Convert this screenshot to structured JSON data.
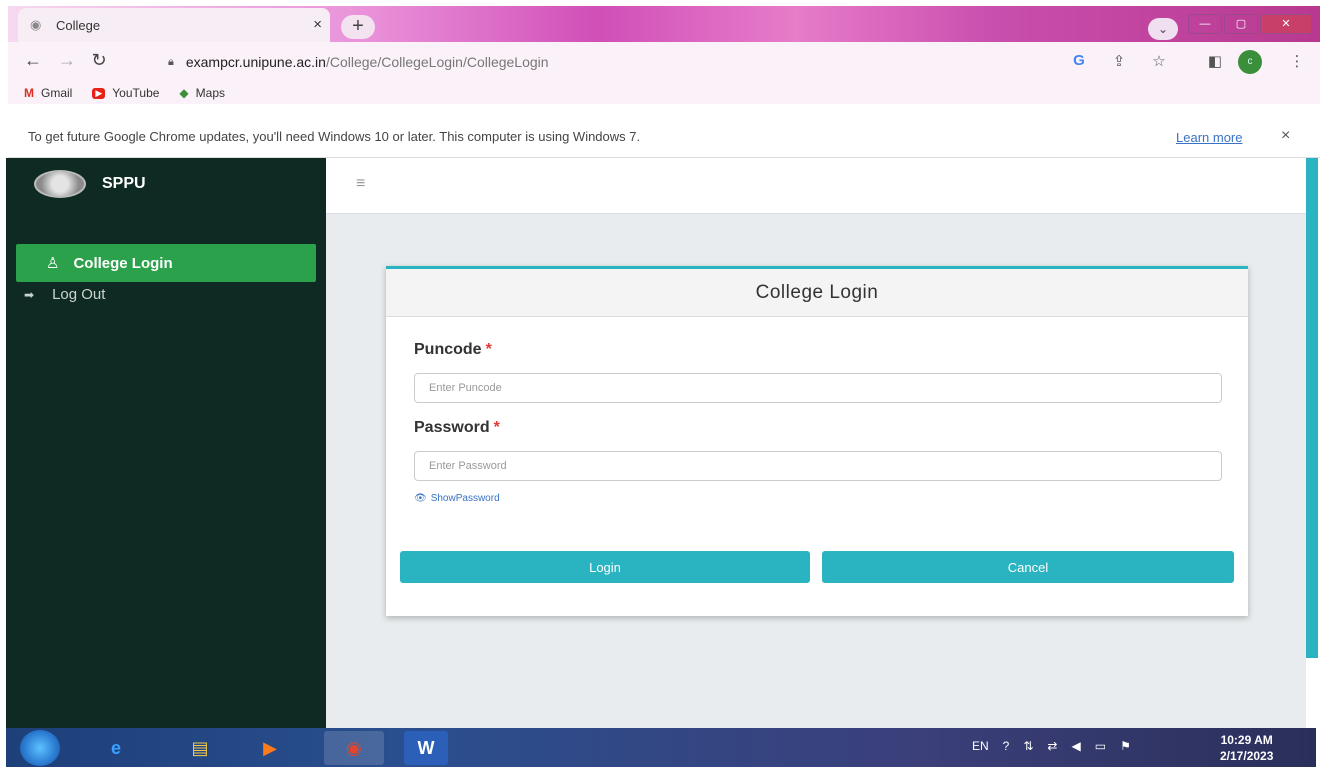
{
  "browser": {
    "tab_title": "College",
    "tab_close": "×",
    "new_tab": "+",
    "url_host": "exampcr.unipune.ac.in",
    "url_path": "/College/CollegeLogin/CollegeLogin",
    "profile_initial": "c"
  },
  "bookmarks": [
    {
      "label": "Gmail",
      "icon": "gmail-icon",
      "glyph": "M",
      "color": "#d93025"
    },
    {
      "label": "YouTube",
      "icon": "youtube-icon",
      "glyph": "▶",
      "color": "#e62117"
    },
    {
      "label": "Maps",
      "icon": "maps-icon",
      "glyph": "◆",
      "color": "#3b8f3a"
    }
  ],
  "infobar": {
    "message": "To get future Google Chrome updates, you'll need Windows 10 or later. This computer is using Windows 7.",
    "learn_more": "Learn more",
    "close": "×"
  },
  "sidebar": {
    "brand": "SPPU",
    "items": [
      {
        "label": "College Login",
        "icon": "user-icon",
        "active": true
      },
      {
        "label": "Log Out",
        "icon": "logout-icon",
        "active": false
      }
    ]
  },
  "login": {
    "title": "College Login",
    "puncode_label": "Puncode",
    "puncode_placeholder": "Enter Puncode",
    "password_label": "Password",
    "password_placeholder": "Enter Password",
    "required_mark": "*",
    "show_password": "ShowPassword",
    "login_button": "Login",
    "cancel_button": "Cancel"
  },
  "taskbar": {
    "language": "EN",
    "time": "10:29 AM",
    "date": "2/17/2023"
  },
  "colors": {
    "accent": "#2ab3c0",
    "sidebar_bg": "#0f2a22",
    "active_item": "#2aa14a"
  }
}
